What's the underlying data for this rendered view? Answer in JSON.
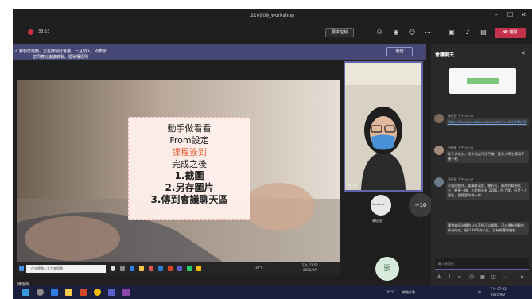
{
  "window": {
    "title": "210909_workshop",
    "minimize": "–",
    "maximize": "☐",
    "close": "✕"
  },
  "toolbar": {
    "recording_time": "33:53",
    "control_button": "要求控制",
    "leave_button": "離開",
    "icons": [
      "people-icon",
      "chat-icon",
      "reactions-icon",
      "more-icon",
      "camera-off-icon",
      "mic-off-icon",
      "share-tray-icon"
    ]
  },
  "banner": {
    "message": "錄製已啟動。正在錄製此會議，一旦加入，即表示您同意此會議錄製。隱私權原則",
    "close_label": "關閉"
  },
  "slide": {
    "lines": [
      "動手做看看",
      "From設定",
      "課程簽到",
      "完成之後",
      "1.截圖",
      "2.另存圖片",
      "3.傳到會議聊天區"
    ]
  },
  "shared_taskbar": {
    "search_placeholder": "在這裡輸入文字來搜尋",
    "weather": "30°C",
    "time": "下午 03:52",
    "date": "2021/9/9"
  },
  "participants": {
    "self_name": "陳怡晴",
    "attendee_initials": "Gustavhi",
    "attendee_name": "陳紀翔",
    "more_count": "+10",
    "bottom_avatar": "張"
  },
  "bottom_name": "陳怡晴",
  "chat": {
    "title": "會議聊天",
    "messages": [
      {
        "meta": "陳紀翔  下午 06:55",
        "text": "https://www.youtube.com/watch?v=8ejYfsfbGIk",
        "is_link": true
      },
      {
        "meta": "張婉蓁  下午 06:55",
        "text": "除了多按步，同步的話可用手機，跟多大學生應用手機一點"
      },
      {
        "meta": "張紀翔  下午 06:57",
        "text": "小組的操作，要講解清楚，需好久，最終的範例太少，結果一條：小組報名有 2266，除了我，但是主人屬主，跟範圍內都一條"
      },
      {
        "meta": "",
        "text": "課常編導永續的公告不但可以開看，可以傳給想看的所有的成，把ELAMS的公告，沒有開權的機制"
      }
    ],
    "input_placeholder": "輸入新訊息",
    "tool_icons": [
      "format-icon",
      "attach-icon",
      "urgent-icon",
      "emoji-icon",
      "gif-icon",
      "sticker-icon",
      "more-icon",
      "send-icon"
    ]
  },
  "taskbar": {
    "weather": "30°C",
    "status": "網路多雲",
    "ime": "中",
    "time": "下午 07:02",
    "date": "2021/9/9"
  }
}
